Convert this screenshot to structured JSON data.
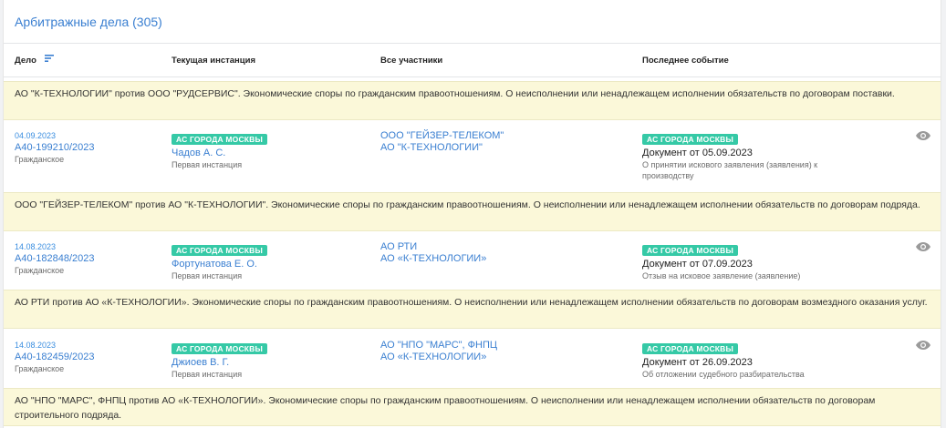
{
  "header": {
    "title": "Арбитражные дела (305)"
  },
  "columns": {
    "case": "Дело",
    "instance": "Текущая инстанция",
    "participants": "Все участники",
    "last_event": "Последнее событие"
  },
  "top_description": "АО \"К-ТЕХНОЛОГИИ\" против ООО \"РУДСЕРВИС\". Экономические споры по гражданским правоотношениям. О неисполнении или ненадлежащем исполнении обязательств по договорам поставки.",
  "cases": [
    {
      "date": "04.09.2023",
      "number": "А40-199210/2023",
      "type": "Гражданское",
      "court": "АС ГОРОДА МОСКВЫ",
      "judge": "Чадов А. С.",
      "instance": "Первая инстанция",
      "participants": [
        "ООО \"ГЕЙЗЕР-ТЕЛЕКОМ\"",
        "АО \"К-ТЕХНОЛОГИИ\""
      ],
      "event_court": "АС ГОРОДА МОСКВЫ",
      "event_doc": "Документ от 05.09.2023",
      "event_desc": [
        "О принятии искового заявления (заявления) к",
        "производству"
      ],
      "description": "ООО \"ГЕЙЗЕР-ТЕЛЕКОМ\" против АО \"К-ТЕХНОЛОГИИ\". Экономические споры по гражданским правоотношениям. О неисполнении или ненадлежащем исполнении обязательств по договорам подряда."
    },
    {
      "date": "14.08.2023",
      "number": "А40-182848/2023",
      "type": "Гражданское",
      "court": "АС ГОРОДА МОСКВЫ",
      "judge": "Фортунатова Е. О.",
      "instance": "Первая инстанция",
      "participants": [
        "АО РТИ",
        "АО «К-ТЕХНОЛОГИИ»"
      ],
      "event_court": "АС ГОРОДА МОСКВЫ",
      "event_doc": "Документ от 07.09.2023",
      "event_desc": [
        "Отзыв на исковое заявление (заявление)"
      ],
      "description": "АО РТИ против АО «К-ТЕХНОЛОГИИ». Экономические споры по гражданским правоотношениям. О неисполнении или ненадлежащем исполнении обязательств по договорам возмездного оказания услуг."
    },
    {
      "date": "14.08.2023",
      "number": "А40-182459/2023",
      "type": "Гражданское",
      "court": "АС ГОРОДА МОСКВЫ",
      "judge": "Джиоев В. Г.",
      "instance": "Первая инстанция",
      "participants": [
        "АО \"НПО \"МАРС\", ФНПЦ",
        "АО «К-ТЕХНОЛОГИИ»"
      ],
      "event_court": "АС ГОРОДА МОСКВЫ",
      "event_doc": "Документ от 26.09.2023",
      "event_desc": [
        "Об отложении судебного разбирательства"
      ],
      "description": "АО \"НПО \"МАРС\", ФНПЦ против АО «К-ТЕХНОЛОГИИ». Экономические споры по гражданским правоотношениям. О неисполнении или ненадлежащем исполнении обязательств по договорам строительного подряда."
    }
  ]
}
